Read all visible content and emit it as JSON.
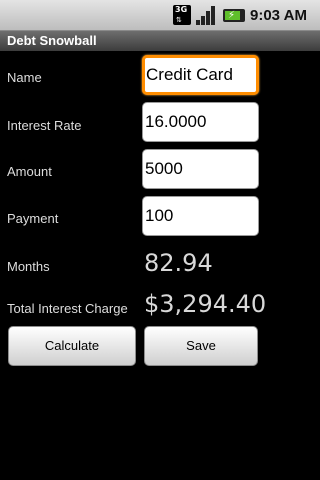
{
  "status_bar": {
    "network_label": "3G",
    "time": "9:03 AM"
  },
  "app": {
    "title": "Debt Snowball"
  },
  "form": {
    "name": {
      "label": "Name",
      "value": "Credit Card"
    },
    "interest_rate": {
      "label": "Interest Rate",
      "value": "16.0000"
    },
    "amount": {
      "label": "Amount",
      "value": "5000"
    },
    "payment": {
      "label": "Payment",
      "value": "100"
    }
  },
  "results": {
    "months": {
      "label": "Months",
      "value": "82.94"
    },
    "total_interest": {
      "label": "Total Interest Charge",
      "value": "$3,294.40"
    }
  },
  "buttons": {
    "calculate": "Calculate",
    "save": "Save"
  },
  "colors": {
    "focus_border": "#ff8d00",
    "battery_fill": "#5fbf2a"
  }
}
